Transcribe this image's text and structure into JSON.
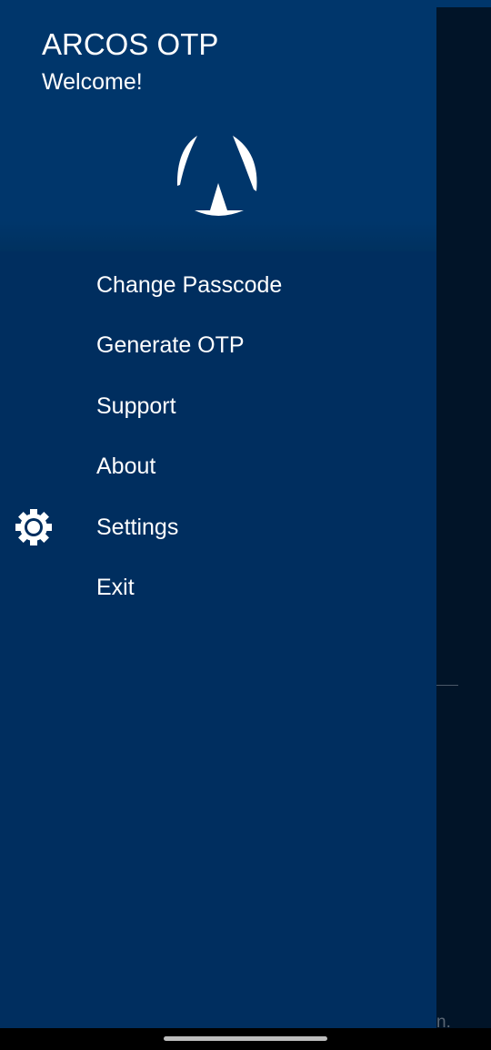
{
  "header": {
    "title": "ARCOS OTP",
    "subtitle": "Welcome!",
    "logo": "arcos-logo"
  },
  "menu": [
    {
      "label": "Change Passcode",
      "icon": null
    },
    {
      "label": "Generate OTP",
      "icon": null
    },
    {
      "label": "Support",
      "icon": null
    },
    {
      "label": "About",
      "icon": null
    },
    {
      "label": "Settings",
      "icon": "gear-icon"
    },
    {
      "label": "Exit",
      "icon": null
    }
  ],
  "background_text": "n.",
  "colors": {
    "drawer": "#002e5f",
    "header": "#00366b",
    "scrim": "#011428"
  }
}
